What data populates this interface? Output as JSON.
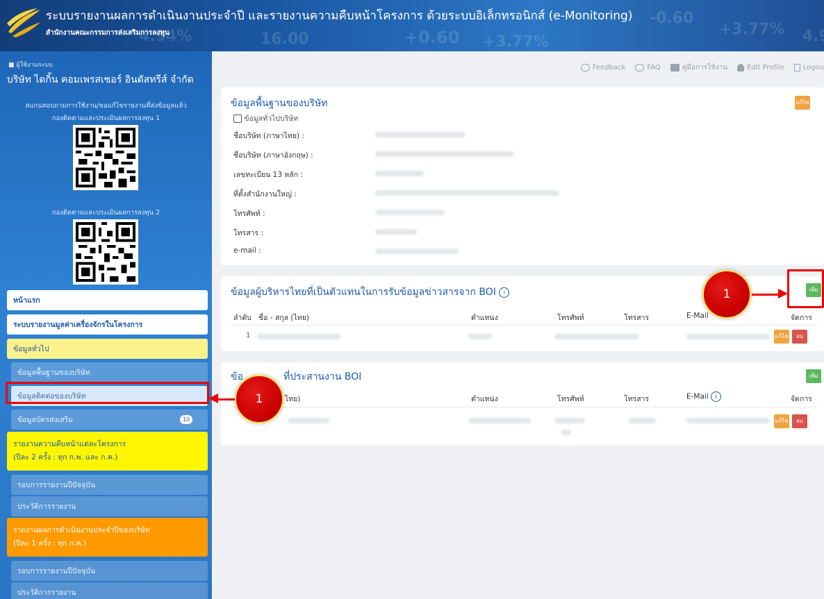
{
  "header": {
    "title": "ระบบรายงานผลการดำเนินงานประจำปี และรายงานความคืบหน้าโครงการ ด้วยระบบอิเล็กทรอนิกส์ (e-Monitoring)",
    "subtitle": "สำนักงานคณะกรรมการส่งเสริมการลงทุน",
    "tickers": [
      "4.94%",
      "16.00",
      "+0.60",
      "+3.77%",
      "-0.60",
      "+3.77%",
      "4.9"
    ]
  },
  "sidebar": {
    "user_role": "ผู้ใช้งานระบบ",
    "user_name": "บริษัท ไดกิ้น คอมเพรสเซอร์ อินดัสทรีส์ จำกัด",
    "scan_text": "สแกนสอบถามการใช้งาน/ขอแก้ไขรายงานที่ส่งข้อมูลแล้ว",
    "qr1_label": "กองติดตามและประเมินผลการลงทุน 1",
    "qr2_label": "กองติดตามและประเมินผลการลงทุน 2",
    "menu": {
      "home": "หน้าแรก",
      "machine_value": "ระบบรายงานมูลค่าเครื่องจักรในโครงการ",
      "general": "ข้อมูลทั่วไป",
      "company_basic": "ข้อมูลพื้นฐานของบริษัท",
      "company_contact": "ข้อมูลติดต่อของบริษัท",
      "promo_cert": "ข้อมูลบัตรส่งเสริม",
      "promo_cert_badge": "10",
      "progress_line1": "รายงานความคืบหน้าแต่ละโครงการ",
      "progress_line2": "(ปีละ 2 ครั้ง : ทุก ก.พ. และ ก.ค.)",
      "current_round_1": "รอบการรายงานปีปัจจุบัน",
      "history_1": "ประวัติการรายงาน",
      "annual_line1": "รายงานผลการดำเนินงานประจำปีของบริษัท",
      "annual_line2": "(ปีละ 1 ครั้ง : ทุก ก.ค.)",
      "current_round_2": "รอบการรายงานปีปัจจุบัน",
      "history_2": "ประวัติการรายงาน"
    }
  },
  "topnav": {
    "feedback": "Feedback",
    "faq": "FAQ",
    "manual": "คู่มือการใช้งาน",
    "edit_profile": "Edit Profile",
    "logout": "Logou"
  },
  "panel1": {
    "title": "ข้อมูลพื้นฐานของบริษัท",
    "subtitle": "ข้อมูลทั่วไปบริษัท",
    "edit_btn": "แก้ไข",
    "fields": [
      "ชื่อบริษัท (ภาษาไทย) :",
      "ชื่อบริษัท (ภาษาอังกฤษ) :",
      "เลขทะเบียน 13 หลัก :",
      "ที่ตั้งสำนักงานใหญ่ :",
      "โทรศัพท์ :",
      "โทรสาร :",
      "e-mail :"
    ]
  },
  "panel2": {
    "title": "ข้อมูลผู้บริหารไทยที่เป็นตัวแทนในการรับข้อมูลข่าวสารจาก BOI",
    "add_btn": "เพิ่ม",
    "headers": [
      "ลำดับ",
      "ชื่อ - สกุล (ไทย)",
      "ตำแหน่ง",
      "โทรศัพท์",
      "โทรสาร",
      "E-Mail",
      "จัดการ"
    ],
    "row_index": "1",
    "edit_btn": "แก้ไข",
    "delete_btn": "ลบ"
  },
  "panel3": {
    "title_left": "ข้อ",
    "title_right": "ที่ประสานงาน BOI",
    "add_btn": "เพิ่ม",
    "headers": [
      "ไทย)",
      "ตำแหน่ง",
      "โทรศัพท์",
      "โทรสาร",
      "E-Mail",
      "จัดการ"
    ],
    "edit_btn": "แก้ไข",
    "delete_btn": "ลบ"
  },
  "callouts": {
    "one": "1",
    "two": "1"
  },
  "colors": {
    "header_blue": "#1c5aa6",
    "title_blue": "#1e59a8",
    "green": "#5cb85c",
    "orange": "#f0a441",
    "red": "#d9534f",
    "annotation_red": "#e00000"
  }
}
